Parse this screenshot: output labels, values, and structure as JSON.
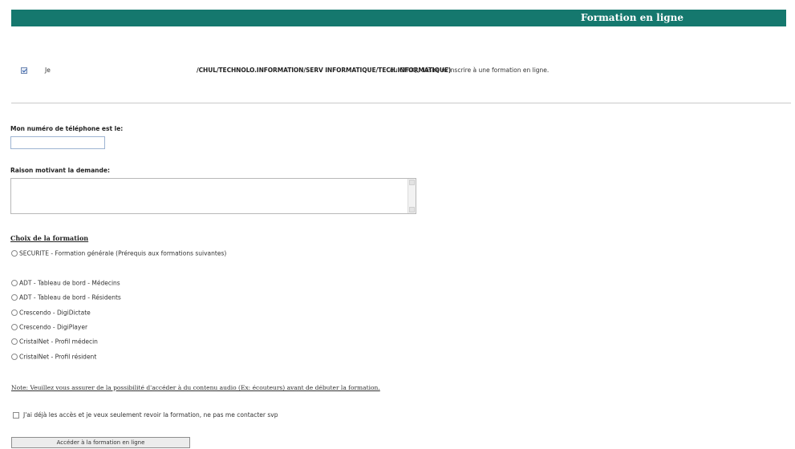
{
  "header": {
    "title": "Formation en ligne"
  },
  "consent": {
    "checked": true,
    "prefix": "Je",
    "path": "/CHUL/TECHNOLO.INFORMATION/SERV INFORMATIQUE/TECH.INFORMATIQUE)",
    "suffix": "du CHUQ, désire m'inscrire à une formation en ligne."
  },
  "phone": {
    "label": "Mon numéro de téléphone est le:",
    "value": ""
  },
  "reason": {
    "label": "Raison motivant la demande:",
    "value": ""
  },
  "training": {
    "title": "Choix de la formation",
    "options": [
      "SECURITE - Formation générale (Prérequis aux formations suivantes)",
      "ADT - Tableau de bord - Médecins",
      "ADT - Tableau de bord - Résidents",
      "Crescendo - DigiDictate",
      "Crescendo - DigiPlayer",
      "CristalNet - Profil médecin",
      "CristalNet - Profil résident"
    ]
  },
  "note": "Note: Veuillez vous assurer de la possibilité d'accéder à du contenu audio (Ex: écouteurs) avant de débuter la formation.",
  "optout": {
    "checked": false,
    "label": "J'ai déjà les accès et je veux seulement revoir la formation, ne pas me contacter svp"
  },
  "submit": {
    "label": "Accéder à la formation en ligne"
  }
}
